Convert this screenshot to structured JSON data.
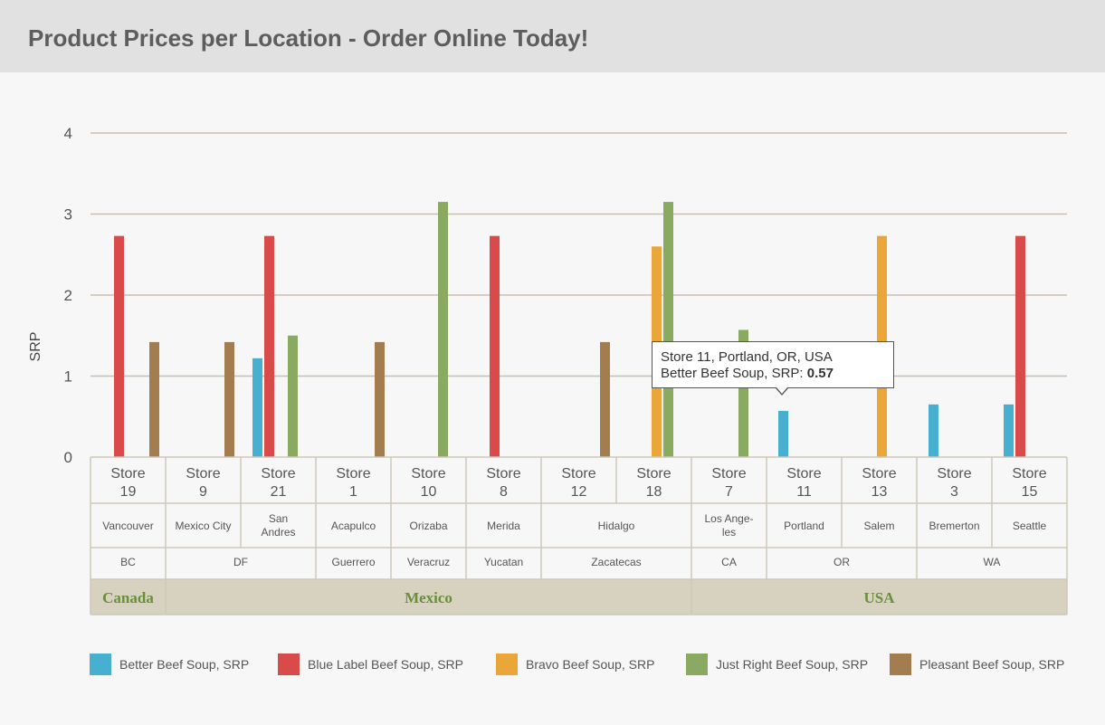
{
  "header": {
    "title": "Product Prices per Location - Order Online Today!"
  },
  "colors": {
    "background": "#f7f7f7",
    "header_bg": "#e1e1e1",
    "gridline": "#c9bfae",
    "table_border": "#cfc8b8",
    "country_bg": "#d7d2c0",
    "country_text": "#6b8e3a"
  },
  "chart_data": {
    "type": "bar",
    "ylabel": "SRP",
    "ylim": [
      0,
      4
    ],
    "yticks": [
      0,
      1,
      2,
      3,
      4
    ],
    "grid": true,
    "categories": [
      [
        "Store",
        "19"
      ],
      [
        "Store",
        "9"
      ],
      [
        "Store",
        "21"
      ],
      [
        "Store",
        "1"
      ],
      [
        "Store",
        "10"
      ],
      [
        "Store",
        "8"
      ],
      [
        "Store",
        "12"
      ],
      [
        "Store",
        "18"
      ],
      [
        "Store",
        "7"
      ],
      [
        "Store",
        "11"
      ],
      [
        "Store",
        "13"
      ],
      [
        "Store",
        "3"
      ],
      [
        "Store",
        "15"
      ]
    ],
    "series": [
      {
        "name": "Better Beef Soup, SRP",
        "color": "#47b0d1",
        "values": [
          null,
          null,
          1.22,
          null,
          null,
          null,
          null,
          null,
          null,
          0.57,
          null,
          0.65,
          0.65
        ]
      },
      {
        "name": "Blue Label Beef Soup, SRP",
        "color": "#d94a4a",
        "values": [
          2.73,
          null,
          2.73,
          null,
          null,
          2.73,
          null,
          null,
          null,
          null,
          null,
          null,
          2.73
        ]
      },
      {
        "name": "Bravo Beef Soup, SRP",
        "color": "#eba63a",
        "values": [
          null,
          null,
          null,
          null,
          null,
          null,
          null,
          2.6,
          null,
          null,
          2.73,
          null,
          null
        ]
      },
      {
        "name": "Just Right Beef Soup, SRP",
        "color": "#8aaa61",
        "values": [
          null,
          null,
          1.5,
          null,
          3.15,
          null,
          null,
          3.15,
          1.57,
          null,
          null,
          null,
          null
        ]
      },
      {
        "name": "Pleasant Beef Soup, SRP",
        "color": "#a37d4f",
        "values": [
          1.42,
          1.42,
          null,
          1.42,
          null,
          null,
          1.42,
          null,
          null,
          null,
          null,
          null,
          null
        ]
      }
    ],
    "hierarchy": {
      "cities": [
        {
          "label": [
            "Vancouver"
          ],
          "span": 1
        },
        {
          "label": [
            "Mexico City"
          ],
          "span": 1
        },
        {
          "label": [
            "San",
            "Andres"
          ],
          "span": 1
        },
        {
          "label": [
            "Acapulco"
          ],
          "span": 1
        },
        {
          "label": [
            "Orizaba"
          ],
          "span": 1
        },
        {
          "label": [
            "Merida"
          ],
          "span": 1
        },
        {
          "label": [
            "Hidalgo"
          ],
          "span": 2
        },
        {
          "label": [
            "Los Ange-",
            "les"
          ],
          "span": 1
        },
        {
          "label": [
            "Portland"
          ],
          "span": 1
        },
        {
          "label": [
            "Salem"
          ],
          "span": 1
        },
        {
          "label": [
            "Bremerton"
          ],
          "span": 1
        },
        {
          "label": [
            "Seattle"
          ],
          "span": 1
        }
      ],
      "states": [
        {
          "label": "BC",
          "span": 1
        },
        {
          "label": "DF",
          "span": 2
        },
        {
          "label": "Guerrero",
          "span": 1
        },
        {
          "label": "Veracruz",
          "span": 1
        },
        {
          "label": "Yucatan",
          "span": 1
        },
        {
          "label": "Zacatecas",
          "span": 2
        },
        {
          "label": "CA",
          "span": 1
        },
        {
          "label": "OR",
          "span": 2
        },
        {
          "label": "WA",
          "span": 2
        }
      ],
      "countries": [
        {
          "label": "Canada",
          "span": 1
        },
        {
          "label": "Mexico",
          "span": 7
        },
        {
          "label": "USA",
          "span": 5
        }
      ]
    },
    "legend_position": "bottom"
  },
  "tooltip": {
    "line1": "Store 11, Portland, OR, USA",
    "line2_prefix": "Better Beef Soup, SRP: ",
    "line2_value": "0.57"
  }
}
